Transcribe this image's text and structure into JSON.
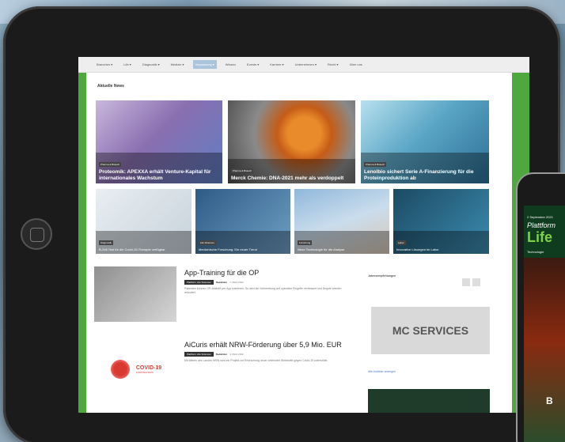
{
  "nav": {
    "items": [
      "Branchen ▾",
      "Life ▾",
      "Diagnostik ▾",
      "Medizin ▾",
      "Verpackung ▾",
      "Wissen",
      "Events ▾",
      "Karriere ▾",
      "Unternehmen ▾",
      "Recht ▾",
      "Über uns"
    ],
    "active_index": 4
  },
  "main": {
    "section_title": "Aktuelle News",
    "featured": [
      {
        "category": "Pharma & Biotech",
        "title": "Proteomik: APEXXA erhält Venture-Kapital für internationales Wachstum"
      },
      {
        "category": "Pharma & Biotech",
        "title": "Merck Chemie: DNA-2021 mehr als verdoppelt"
      },
      {
        "category": "Pharma & Biotech",
        "title": "Lenolbio sichert Serie A-Finanzierung für die Proteinproduktion ab"
      }
    ],
    "secondary": [
      {
        "category": "Diagnostik",
        "title": "B-Zell-Test für die Covid-19-Therapie verfügbar"
      },
      {
        "category": "Life Sciences",
        "title": "Medizinische Forschung: Ein neuer Trend"
      },
      {
        "category": "Forschung",
        "title": "Neue Technologie für die Analyse"
      },
      {
        "category": "Labor",
        "title": "Innovative Lösungen im Labor"
      }
    ],
    "articles": [
      {
        "title": "App-Training für die OP",
        "category": "Plattform Life Sciences",
        "author": "Redaktion",
        "date": "7. März 2022",
        "excerpt": "Patienten können OP-Abläufe per App trainieren. So wird die Vorbereitung auf operative Eingriffe verbessert und Ängste werden reduziert."
      },
      {
        "title": "AiCuris erhält NRW-Förderung über 5,9 Mio. EUR",
        "category": "Plattform Life Sciences",
        "author": "Redaktion",
        "date": "4. März 2022",
        "excerpt": "Mit Mitteln des Landes NRW wird ein Projekt zur Erforschung neuer antiviraler Wirkstoffe gegen Covid-19 unterstützt."
      }
    ],
    "covid_logo": {
      "text": "COVID-19",
      "sub": "CORONAVIRUS"
    }
  },
  "sidebar": {
    "heading": "Jahresempfehlungen",
    "ad_text": "MC SERVICES",
    "link": "Alle Anbieter anzeigen"
  },
  "phone": {
    "small": "2  September 2021",
    "italic": "Plattform",
    "big": "Life",
    "tag": "Technologie",
    "letter": "B"
  },
  "colors": {
    "green": "#4fa83d",
    "nav_active": "#aac4dc"
  }
}
